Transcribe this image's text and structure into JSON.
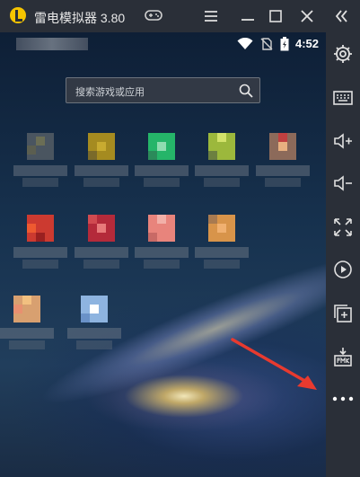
{
  "titlebar": {
    "app_name": "雷电模拟器 3.80"
  },
  "statusbar": {
    "time": "4:52"
  },
  "search": {
    "placeholder": "搜索游戏或应用"
  },
  "apps": [
    {
      "name": "app-1",
      "color": "#8a8a60"
    },
    {
      "name": "app-2",
      "color": "#b8a020"
    },
    {
      "name": "app-3",
      "color": "#2fbf6a"
    },
    {
      "name": "app-4",
      "color": "#b6cc44"
    },
    {
      "name": "app-5",
      "color": "#c04040"
    },
    {
      "name": "app-6",
      "color": "#d13a2a"
    },
    {
      "name": "app-7",
      "color": "#b82a3c"
    },
    {
      "name": "app-8",
      "color": "#ec8a84"
    },
    {
      "name": "app-9",
      "color": "#e8a450"
    },
    {
      "name": "app-10",
      "color": "#f0a060"
    },
    {
      "name": "app-11",
      "color": "#7ea8e0"
    }
  ],
  "sidebar": {
    "items": [
      "settings",
      "keyboard",
      "volume-up",
      "volume-down",
      "fullscreen",
      "screen-record",
      "multi-instance",
      "install-apk",
      "more"
    ]
  },
  "colors": {
    "titlebar_bg": "#2a2f38",
    "sidebar_bg": "#2a2f38",
    "accent_logo": "#f5c400",
    "arrow": "#e83a2f"
  }
}
